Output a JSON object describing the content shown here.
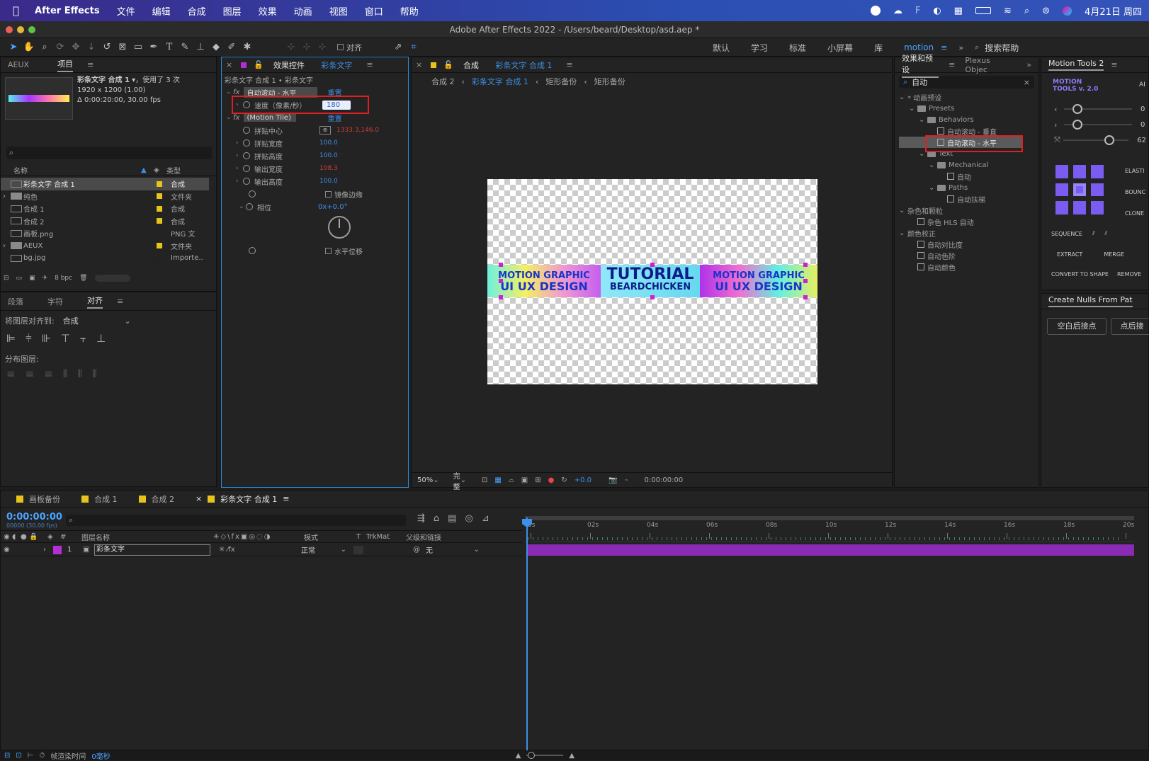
{
  "menubar": {
    "apple_icon": "apple-icon",
    "app_name": "After Effects",
    "items": [
      "文件",
      "编辑",
      "合成",
      "图层",
      "效果",
      "动画",
      "视图",
      "窗口",
      "帮助"
    ],
    "datetime": "4月21日 周四"
  },
  "window": {
    "title": "Adobe After Effects 2022 - /Users/beard/Desktop/asd.aep *"
  },
  "toolbar": {
    "align_label": "对齐",
    "workspaces": [
      "默认",
      "学习",
      "标准",
      "小屏幕",
      "库",
      "motion"
    ],
    "active_workspace": "motion",
    "search_placeholder": "搜索帮助"
  },
  "project": {
    "tabs": [
      "AEUX",
      "项目"
    ],
    "comp_name": "彩条文字 合成 1",
    "used": "，使用了 3 次",
    "res": "1920 x 1200 (1.00)",
    "duration": "Δ 0:00:20:00, 30.00 fps",
    "col_name": "名称",
    "col_type": "类型",
    "items": [
      {
        "name": "彩条文字 合成 1",
        "type": "合成",
        "color": "#e6c419",
        "icon": "comp-icon",
        "selected": true
      },
      {
        "name": "纯色",
        "type": "文件夹",
        "color": "#e6c419",
        "icon": "folder-icon"
      },
      {
        "name": "合成 1",
        "type": "合成",
        "color": "#e6c419",
        "icon": "comp-icon"
      },
      {
        "name": "合成 2",
        "type": "合成",
        "color": "#e6c419",
        "icon": "comp-icon"
      },
      {
        "name": "画板.png",
        "type": "PNG 文",
        "color": "#222",
        "icon": "file-icon"
      },
      {
        "name": "AEUX",
        "type": "文件夹",
        "color": "#e6c419",
        "icon": "folder-icon"
      },
      {
        "name": "bg.jpg",
        "type": "Importe..",
        "color": "#222",
        "icon": "file-icon"
      }
    ],
    "bpc": "8 bpc"
  },
  "align": {
    "tabs": [
      "段落",
      "字符",
      "对齐"
    ],
    "align_to_label": "将图层对齐到:",
    "align_to_value": "合成",
    "distribute_label": "分布图层:"
  },
  "effects": {
    "tab_prefix": "效果控件",
    "tab_layer": "彩条文字",
    "breadcrumb": "彩条文字 合成 1 • 彩条文字",
    "fx1_name": "自动滚动 - 水平",
    "reset": "重置",
    "speed_label": "速度（像素/秒）",
    "speed_value": "180",
    "fx2_name": "(Motion Tile)",
    "params": [
      {
        "label": "拼贴中心",
        "value": "1333.3,146.0",
        "red": true,
        "point": true,
        "expand": false
      },
      {
        "label": "拼贴宽度",
        "value": "100.0",
        "red": false,
        "expand": true
      },
      {
        "label": "拼贴高度",
        "value": "100.0",
        "red": false,
        "expand": true
      },
      {
        "label": "输出宽度",
        "value": "108.3",
        "red": true,
        "expand": true
      },
      {
        "label": "输出高度",
        "value": "100.0",
        "red": false,
        "expand": true
      }
    ],
    "mirror_label": "镜像边缘",
    "phase_label": "相位",
    "phase_value": "0x+0.0°",
    "hshift_label": "水平位移"
  },
  "composition": {
    "tab_prefix": "合成",
    "tab_name": "彩条文字 合成 1",
    "crumbs": [
      "合成 2",
      "彩条文字 合成 1",
      "矩形备份",
      "矩形备份"
    ],
    "banner": {
      "left_top": "MOTION GRAPHIC",
      "left_bottom": "UI UX DESIGN",
      "center_top": "TUTORIAL",
      "center_bottom": "BEARDCHICKEN",
      "right_top": "MOTION GRAPHIC",
      "right_bottom": "UI UX DESIGN"
    },
    "zoom": "50%",
    "quality": "完整",
    "exposure": "+0.0",
    "timecode": "0:00:00:00"
  },
  "presets": {
    "tabs": [
      "效果和预设",
      "Plexus Objec"
    ],
    "search_value": "自动",
    "tree": [
      {
        "label": "* 动画预设",
        "indent": 0,
        "kind": "arrow"
      },
      {
        "label": "Presets",
        "indent": 1,
        "kind": "folder"
      },
      {
        "label": "Behaviors",
        "indent": 2,
        "kind": "folder"
      },
      {
        "label": "自动滚动 - 垂直",
        "indent": 3,
        "kind": "preset"
      },
      {
        "label": "自动滚动 - 水平",
        "indent": 3,
        "kind": "preset",
        "selected": true
      },
      {
        "label": "Text",
        "indent": 2,
        "kind": "folder"
      },
      {
        "label": "Mechanical",
        "indent": 3,
        "kind": "folder"
      },
      {
        "label": "自动",
        "indent": 4,
        "kind": "preset"
      },
      {
        "label": "Paths",
        "indent": 3,
        "kind": "folder"
      },
      {
        "label": "自动扶梯",
        "indent": 4,
        "kind": "preset"
      },
      {
        "label": "杂色和颗粒",
        "indent": 0,
        "kind": "arrow"
      },
      {
        "label": "杂色 HLS 自动",
        "indent": 1,
        "kind": "preset"
      },
      {
        "label": "颜色校正",
        "indent": 0,
        "kind": "arrow"
      },
      {
        "label": "自动对比度",
        "indent": 1,
        "kind": "preset"
      },
      {
        "label": "自动色阶",
        "indent": 1,
        "kind": "preset"
      },
      {
        "label": "自动颜色",
        "indent": 1,
        "kind": "preset"
      }
    ]
  },
  "motion_tools": {
    "tab": "Motion Tools 2",
    "logo": "MOTION TOOLS v. 2.0",
    "ai": "AI",
    "slider_values": [
      "0",
      "0",
      "62"
    ],
    "side_labels": [
      "ELASTI",
      "BOUNC",
      "CLONE"
    ],
    "buttons": [
      "SEQUENCE",
      "EXTRACT",
      "MERGE",
      "CONVERT TO SHAPE",
      "REMOVE"
    ],
    "nulls_tab": "Create Nulls From Pat",
    "nulls_buttons": [
      "空白后接点",
      "点后接"
    ]
  },
  "timeline": {
    "tabs": [
      {
        "label": "画板备份",
        "color": "#e6c419"
      },
      {
        "label": "合成 1",
        "color": "#e6c419"
      },
      {
        "label": "合成 2",
        "color": "#e6c419"
      },
      {
        "label": "彩条文字 合成 1",
        "color": "#e6c419",
        "active": true
      }
    ],
    "timecode": "0:00:00:00",
    "frames": "00000 (30.00 fps)",
    "col_layer_name": "图层名称",
    "col_mode": "模式",
    "col_t": "T",
    "col_trkmat": "TrkMat",
    "col_parent": "父级和链接",
    "ruler": [
      "0s",
      "02s",
      "04s",
      "06s",
      "08s",
      "10s",
      "12s",
      "14s",
      "16s",
      "18s",
      "20s"
    ],
    "layer": {
      "index": "1",
      "name": "彩条文字",
      "mode": "正常",
      "parent": "无",
      "color": "#b22ed6"
    },
    "bar_color": "#8a2bb5"
  },
  "statusbar": {
    "label": "帧渲染时间",
    "value": "0毫秒"
  }
}
